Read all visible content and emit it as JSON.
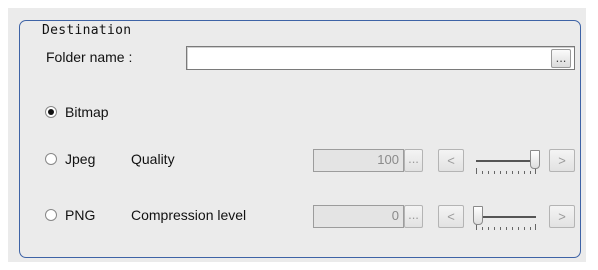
{
  "destination": {
    "legend": "Destination",
    "folder_label": "Folder name :",
    "folder_value": "",
    "browse_label": "..."
  },
  "formats": [
    {
      "label": "Bitmap",
      "selected": true
    },
    {
      "label": "Jpeg",
      "selected": false,
      "option_label": "Quality",
      "value": "100",
      "ellipsis": "...",
      "dec_label": "<",
      "inc_label": ">",
      "slider_level_percent": 100
    },
    {
      "label": "PNG",
      "selected": false,
      "option_label": "Compression level",
      "value": "0",
      "ellipsis": "...",
      "dec_label": "<",
      "inc_label": ">",
      "slider_level_percent": 0
    }
  ],
  "colors": {
    "group_border": "#3e63a6",
    "panel_bg": "#ebebeb"
  }
}
